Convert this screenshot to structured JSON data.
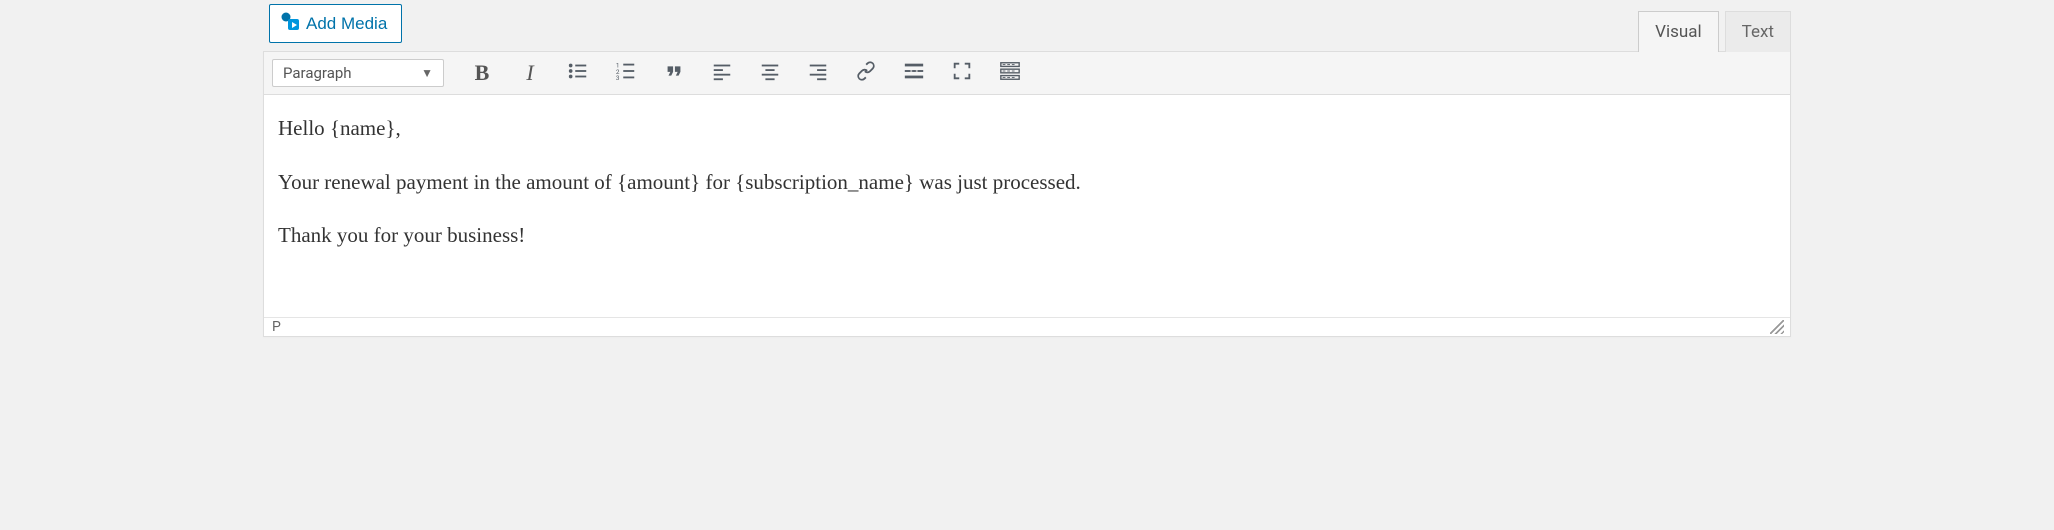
{
  "toolbar_top": {
    "add_media_label": "Add Media"
  },
  "tabs": {
    "visual": "Visual",
    "text": "Text"
  },
  "format_dropdown": {
    "selected": "Paragraph"
  },
  "toolbar_buttons": {
    "bold": "B",
    "italic": "I"
  },
  "content": {
    "p1": "Hello {name},",
    "p2": "Your renewal payment in the amount of {amount} for {subscription_name} was just processed.",
    "p3": "Thank you for your business!"
  },
  "statusbar": {
    "path": "P"
  }
}
